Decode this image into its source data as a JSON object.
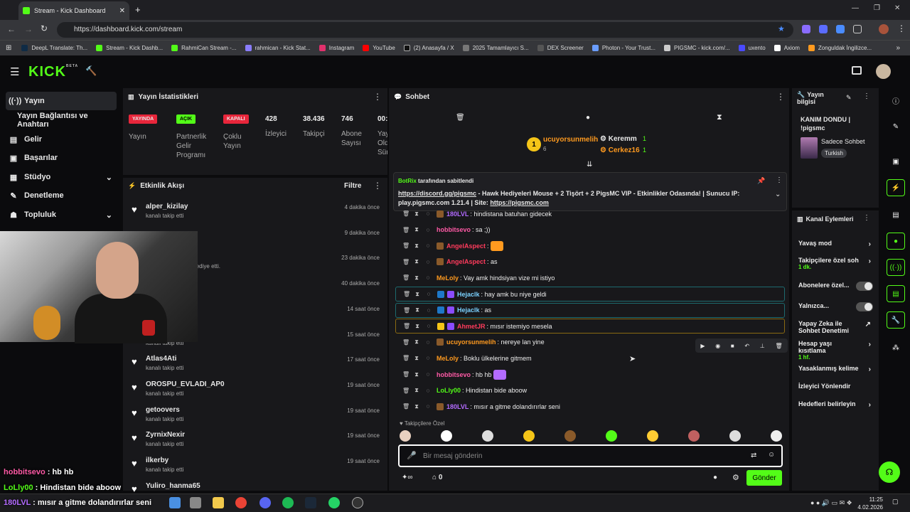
{
  "browser": {
    "tab_title": "Stream - Kick Dashboard",
    "url": "https://dashboard.kick.com/stream",
    "bookmarks": [
      "DeepL Translate: Th...",
      "Stream - Kick Dashb...",
      "RahmiCan Stream -...",
      "rahmican - Kick Stat...",
      "Instagram",
      "YouTube",
      "(2) Anasayfa / X",
      "2025 Tamamlayıcı S...",
      "DEX Screener",
      "Photon - Your Trust...",
      "PIGSMC - kick.com/...",
      "uxento",
      "Axiom",
      "Zonguldak İngilizce..."
    ]
  },
  "logo": {
    "text": "KICK",
    "beta": "BETA"
  },
  "nav": [
    {
      "label": "Yayın",
      "icon": "((·))"
    },
    {
      "label": "Yayın Bağlantısı ve Anahtarı",
      "icon": ""
    },
    {
      "label": "Gelir",
      "icon": "▤"
    },
    {
      "label": "Başarılar",
      "icon": "▣"
    },
    {
      "label": "Stüdyo",
      "icon": "▦"
    },
    {
      "label": "Denetleme",
      "icon": "✎"
    },
    {
      "label": "Topluluk",
      "icon": "☗"
    }
  ],
  "stats": {
    "title": "Yayın İstatistikleri",
    "badges": [
      {
        "badge": "YAYINDA",
        "label": "Yayın",
        "color": "#e8263b"
      },
      {
        "badge": "AÇIK",
        "label": "Partnerlik\nGelir\nProgramı",
        "color": "#53fc18"
      },
      {
        "badge": "KAPALI",
        "label": "Çoklu\nYayın",
        "color": "#e8263b"
      }
    ],
    "numbers": [
      {
        "value": "428",
        "label": "İzleyici"
      },
      {
        "value": "38.436",
        "label": "Takipçi"
      },
      {
        "value": "746",
        "label": "Abone\nSayısı"
      },
      {
        "value": "00:",
        "label": "Yay\nOld\nSür"
      }
    ]
  },
  "activity": {
    "title": "Etkinlik Akışı",
    "filter": "Filtre",
    "items": [
      {
        "name": "alper_kizilay",
        "sub": "kanalı takip etti",
        "time": "4 dakika önce"
      },
      {
        "name": "",
        "sub": "",
        "time": "9 dakika önce"
      },
      {
        "name": "",
        "sub": "nlanıcıya abonelik hediye etti.",
        "time": "23 dakika önce"
      },
      {
        "name": "",
        "sub": "",
        "time": "40 dakika önce"
      },
      {
        "name": "",
        "sub": "",
        "time": "14 saat önce"
      },
      {
        "name": "",
        "sub": "kanalı takip etti",
        "time": "15 saat önce"
      },
      {
        "name": "Atlas4Ati",
        "sub": "kanalı takip etti",
        "time": "17 saat önce"
      },
      {
        "name": "OROSPU_EVLADI_AP0",
        "sub": "kanalı takip etti",
        "time": "19 saat önce"
      },
      {
        "name": "getoovers",
        "sub": "kanalı takip etti",
        "time": "19 saat önce"
      },
      {
        "name": "ZyrnixNexir",
        "sub": "kanalı takip etti",
        "time": "19 saat önce"
      },
      {
        "name": "ilkerby",
        "sub": "kanalı takip etti",
        "time": "19 saat önce"
      },
      {
        "name": "Yuliro_hanma65",
        "sub": "",
        "time": ""
      }
    ]
  },
  "overlay_chat": [
    {
      "user": "hobbitsevo",
      "text": " : hb hb"
    },
    {
      "user": "LoLly00",
      "text": " : Hindistan bide aboow"
    },
    {
      "user": "180LVL",
      "text": " : mısır a gitme dolandırırlar seni"
    }
  ],
  "chat": {
    "title": "Sohbet",
    "leaders": {
      "top": {
        "rank": "1",
        "user": "ucuyorsunmelih",
        "count": "6"
      },
      "others": [
        {
          "user": "Keremm",
          "count": "1"
        },
        {
          "user": "Cerkez16",
          "count": "1"
        }
      ]
    },
    "pinned": {
      "by_user": "BotRix",
      "by_text": "tarafından sabitlendi",
      "link1": "https://discord.gg/pigsmc",
      "text1": " - Hawk Hediyeleri",
      "text2": " Mouse + 2 Tişört + 2 PigsMC VIP - Etkinlikler Odasında! | Sunucu IP: play.pigsmc.com 1.21.4 | Site: ",
      "link2": "https://pigsmc.com"
    },
    "messages": [
      {
        "user": "180LVL",
        "color": "#b36bff",
        "text": "hindistana batuhan gidecek",
        "style": ""
      },
      {
        "user": "hobbitsevo",
        "color": "#ff5aa6",
        "text": "sa ;))",
        "style": ""
      },
      {
        "user": "AngelAspect",
        "color": "#ff3b5c",
        "text": "",
        "style": "",
        "emote": true
      },
      {
        "user": "AngelAspect",
        "color": "#ff3b5c",
        "text": "as",
        "style": ""
      },
      {
        "user": "MeLoly",
        "color": "#ff9a1f",
        "text": "Vay amk hindsiyan vize mi istiyo",
        "style": ""
      },
      {
        "user": "Hejaclk",
        "color": "#7ad1ff",
        "text": "hay amk bu niye geldi",
        "style": "box"
      },
      {
        "user": "Hejaclk",
        "color": "#7ad1ff",
        "text": "as",
        "style": "box"
      },
      {
        "user": "AhmetJR",
        "color": "#ff3b5c",
        "text": "mısır istemiyo mesela",
        "style": "gold"
      },
      {
        "user": "ucuyorsunmelih",
        "color": "#ff9a1f",
        "text": "nereye lan yine",
        "style": ""
      },
      {
        "user": "MeLoly",
        "color": "#ff9a1f",
        "text": "Boklu ülkelerine gitmem",
        "style": ""
      },
      {
        "user": "hobbitsevo",
        "color": "#ff5aa6",
        "text": "hb hb",
        "style": "",
        "emote": true
      },
      {
        "user": "LoLly00",
        "color": "#53fc18",
        "text": "Hindistan bide aboow",
        "style": ""
      },
      {
        "user": "180LVL",
        "color": "#b36bff",
        "text": "mısır a gitme dolandırırlar seni",
        "style": ""
      }
    ],
    "followers_only": "Takipçilere Özel",
    "placeholder": "Bir mesaj gönderin",
    "points": "0",
    "send": "Gönder"
  },
  "stream_info": {
    "title": "Yayın bilgisi",
    "stream_title": "KANIM DONDU | !pigsmc",
    "category": "Sadece Sohbet",
    "language": "Turkish"
  },
  "channel_actions": {
    "title": "Kanal Eylemleri",
    "items": [
      {
        "label": "Yavaş mod",
        "sub": "",
        "control": "arrow"
      },
      {
        "label": "Takipçilere özel soh",
        "sub": "1 dk.",
        "control": "arrow"
      },
      {
        "label": "Abonelere özel...",
        "sub": "",
        "control": "toggle"
      },
      {
        "label": "Yalnızca...",
        "sub": "",
        "control": "toggle"
      },
      {
        "label": "Yapay Zeka ile Sohbet Denetimi",
        "sub": "",
        "control": "ext"
      },
      {
        "label": "Hesap yaşı kısıtlama",
        "sub": "1 hf.",
        "control": "arrow"
      },
      {
        "label": "Yasaklanmış kelime",
        "sub": "",
        "control": "arrow"
      },
      {
        "label": "İzleyici Yönlendir",
        "sub": "",
        "control": "none"
      },
      {
        "label": "Hedefleri belirleyin",
        "sub": "",
        "control": "arrow"
      }
    ]
  },
  "taskbar": {
    "time": "11:25",
    "date": "4.02.2026"
  }
}
